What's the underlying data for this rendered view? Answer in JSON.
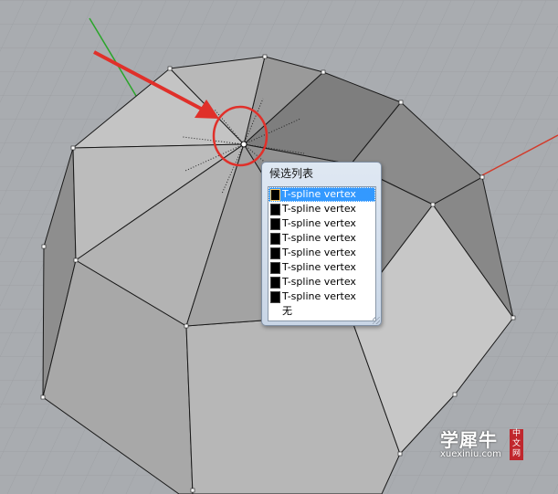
{
  "popup": {
    "title": "候选列表",
    "items": [
      {
        "label": "T-spline vertex",
        "selected": true
      },
      {
        "label": "T-spline vertex",
        "selected": false
      },
      {
        "label": "T-spline vertex",
        "selected": false
      },
      {
        "label": "T-spline vertex",
        "selected": false
      },
      {
        "label": "T-spline vertex",
        "selected": false
      },
      {
        "label": "T-spline vertex",
        "selected": false
      },
      {
        "label": "T-spline vertex",
        "selected": false
      },
      {
        "label": "T-spline vertex",
        "selected": false
      }
    ],
    "none_label": "无"
  },
  "watermark": {
    "text": "学犀牛",
    "url": "xuexiniu.com",
    "badge": "中文网"
  },
  "colors": {
    "background": "#a9acb0",
    "highlight_circle": "#e0302a",
    "arrow": "#e0302a",
    "selection": "#3399ff"
  }
}
